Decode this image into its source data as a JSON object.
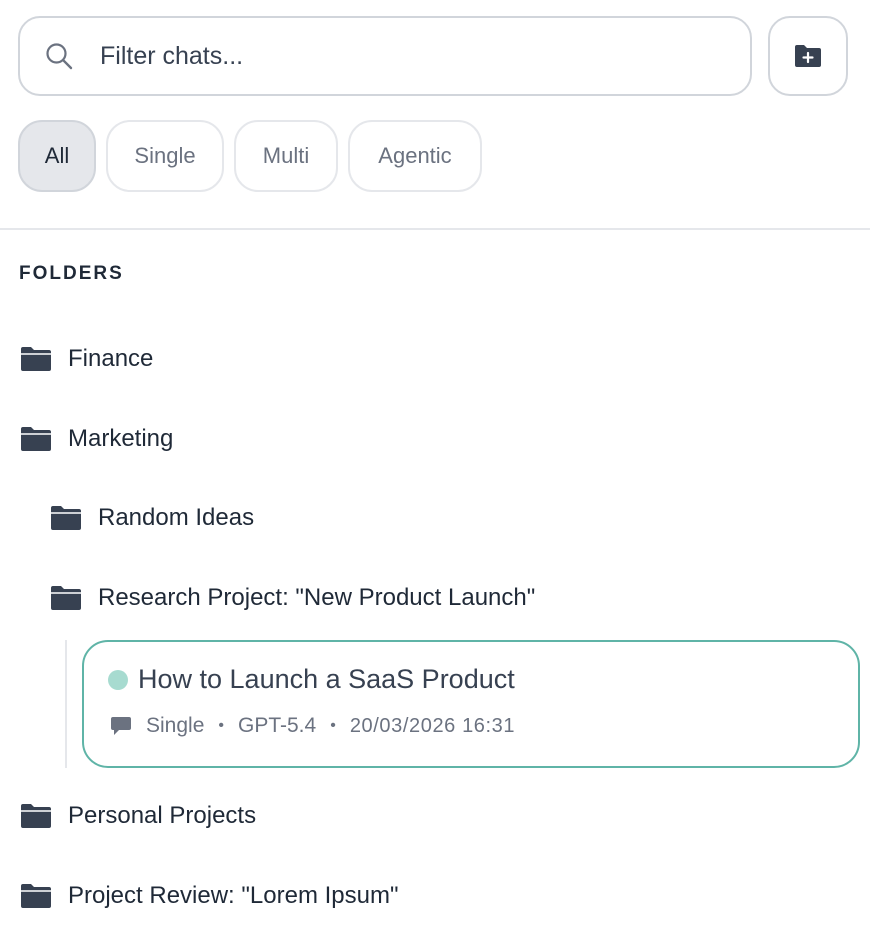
{
  "search": {
    "placeholder": "Filter chats..."
  },
  "filters": [
    {
      "label": "All",
      "active": true
    },
    {
      "label": "Single",
      "active": false
    },
    {
      "label": "Multi",
      "active": false
    },
    {
      "label": "Agentic",
      "active": false
    }
  ],
  "folders_section": {
    "title": "FOLDERS",
    "items": [
      {
        "label": "Finance",
        "level": 0
      },
      {
        "label": "Marketing",
        "level": 0
      },
      {
        "label": "Random Ideas",
        "level": 1
      },
      {
        "label": "Research Project: \"New Product Launch\"",
        "level": 1
      },
      {
        "label": "Personal Projects",
        "level": 0
      },
      {
        "label": "Project Review: \"Lorem Ipsum\"",
        "level": 0
      }
    ]
  },
  "chat": {
    "title": "How to Launch a SaaS Product",
    "mode": "Single",
    "model": "GPT-5.4",
    "datetime": "20/03/2026 16:31",
    "separator": "•"
  },
  "icons": {
    "search": "search-icon",
    "new_folder": "folder-plus-icon",
    "folder": "folder-icon",
    "chat_mode": "chat-bubble-icon"
  },
  "colors": {
    "accent_border": "#5fb4a7",
    "status_dot": "#a7dbd0",
    "folder_icon": "#374151",
    "active_chip_bg": "#e5e7eb"
  }
}
